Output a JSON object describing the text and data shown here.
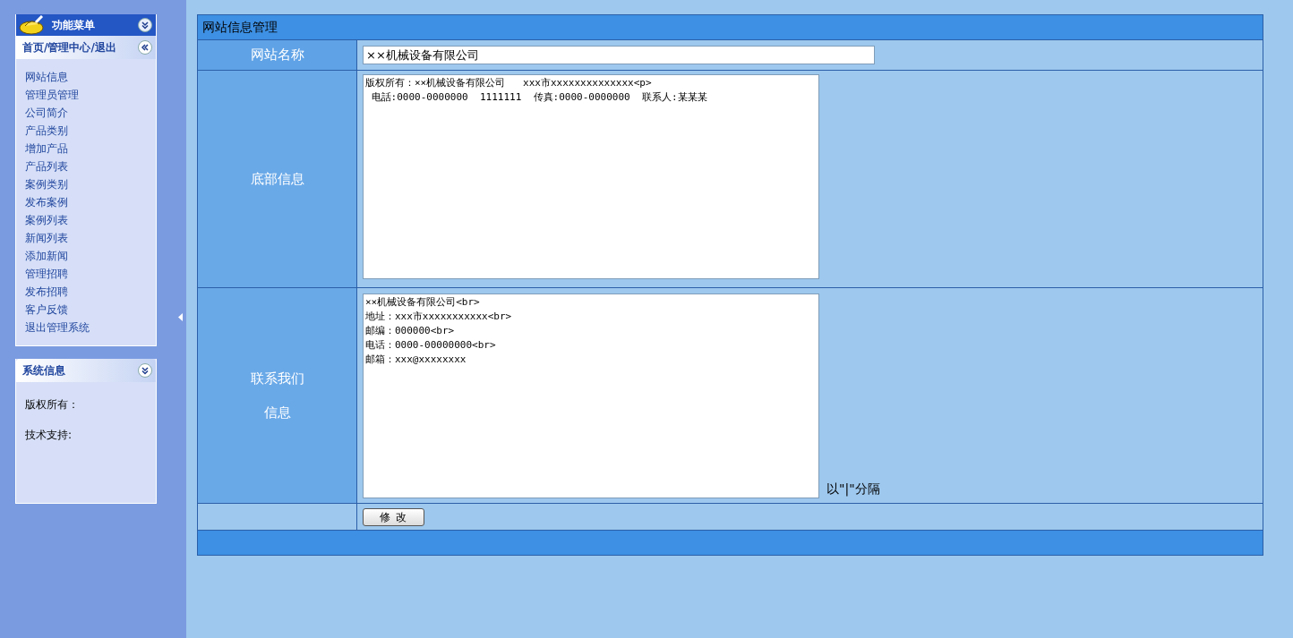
{
  "sidebar": {
    "menu_panel": {
      "title": "功能菜单",
      "subtitle": "首页/管理中心/退出",
      "items": [
        "网站信息",
        "管理员管理",
        "公司简介",
        "产品类别",
        "增加产品",
        "产品列表",
        "案例类别",
        "发布案例",
        "案例列表",
        "新闻列表",
        "添加新闻",
        "管理招聘",
        "发布招聘",
        "客户反馈",
        "退出管理系统"
      ]
    },
    "info_panel": {
      "title": "系统信息",
      "lines": [
        "版权所有：",
        "技术支持:"
      ]
    }
  },
  "form": {
    "title": "网站信息管理",
    "site_name": {
      "label": "网站名称",
      "value": "××机械设备有限公司"
    },
    "footer_info": {
      "label": "底部信息",
      "value": "版权所有：××机械设备有限公司   xxx市xxxxxxxxxxxxxx<p>\n 电話:0000-0000000  1111111  传真:0000-0000000  联系人:某某某"
    },
    "contact_info": {
      "label_lines": [
        "联系我们",
        "信息"
      ],
      "value": "××机械设备有限公司<br>\n地址：xxx市xxxxxxxxxxx<br>\n邮编：000000<br>\n电话：0000-00000000<br>\n邮箱：xxx@xxxxxxxx",
      "hint": "以\"|\"分隔"
    },
    "submit_button": "修 改"
  }
}
